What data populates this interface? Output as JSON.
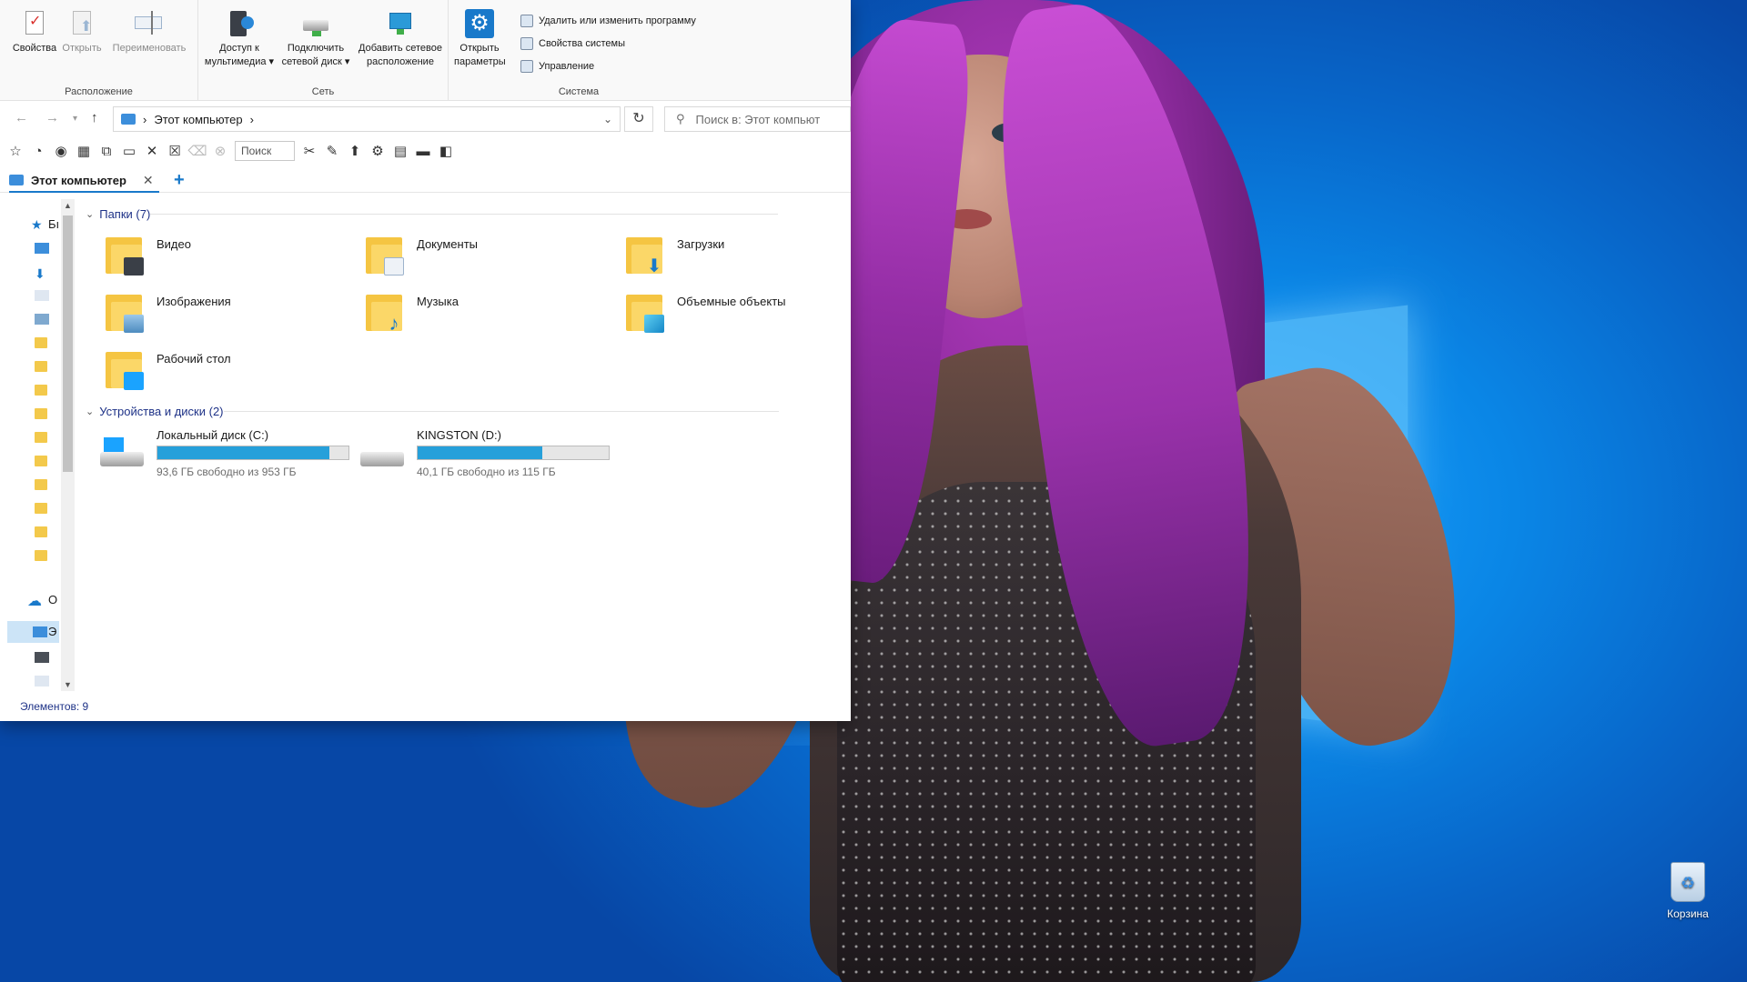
{
  "ribbon": {
    "groups": [
      {
        "label": "Расположение",
        "buttons": [
          "Свойства",
          "Открыть",
          "Переименовать"
        ]
      },
      {
        "label": "Сеть",
        "buttons": [
          "Доступ к мультимедиа",
          "Подключить сетевой диск",
          "Добавить сетевое расположение"
        ]
      },
      {
        "label": "Система",
        "buttons": [
          "Открыть параметры"
        ]
      }
    ],
    "access_media_line1": "Доступ к",
    "access_media_line2": "мультимедиа",
    "map_drive_line1": "Подключить",
    "map_drive_line2": "сетевой диск",
    "add_location_line1": "Добавить сетевое",
    "add_location_line2": "расположение",
    "open_settings_line1": "Открыть",
    "open_settings_line2": "параметры",
    "system_commands": [
      "Удалить или изменить программу",
      "Свойства системы",
      "Управление"
    ]
  },
  "address": {
    "path": "Этот компьютер",
    "search_placeholder": "Поиск в: Этот компьют"
  },
  "toolbar": {
    "search_label": "Поиск"
  },
  "tab": {
    "label": "Этот компьютер"
  },
  "navpane": {
    "items": [
      "Бı",
      "О",
      "Э"
    ]
  },
  "sections": {
    "folders_header": "Папки (7)",
    "devices_header": "Устройства и диски (2)"
  },
  "folders": [
    "Видео",
    "Документы",
    "Загрузки",
    "Изображения",
    "Музыка",
    "Объемные объекты",
    "Рабочий стол"
  ],
  "drives": [
    {
      "name": "Локальный диск (C:)",
      "free": "93,6 ГБ свободно из 953 ГБ",
      "used_fraction": 0.902
    },
    {
      "name": "KINGSTON (D:)",
      "free": "40,1 ГБ свободно из 115 ГБ",
      "used_fraction": 0.651
    }
  ],
  "status": {
    "items": "Элементов: 9"
  },
  "desktop": {
    "recycle_bin": "Корзина"
  },
  "colors": {
    "accent": "#1979ca",
    "bar_fill": "#26a0da",
    "section_text": "#1e3287"
  }
}
